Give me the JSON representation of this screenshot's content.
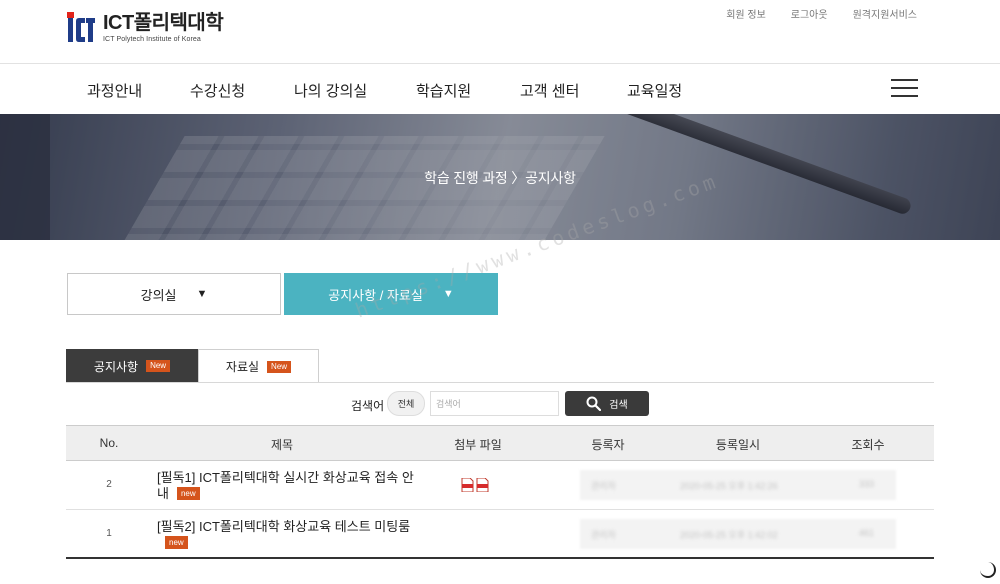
{
  "site": {
    "logo_title": "ICT폴리텍대학",
    "logo_subtitle": "ICT Polytech Institute of Korea"
  },
  "utility_links": [
    "회원 정보",
    "로그아웃",
    "원격지원서비스"
  ],
  "gnb": [
    "과정안내",
    "수강신청",
    "나의 강의실",
    "학습지원",
    "고객 센터",
    "교육일정"
  ],
  "banner": {
    "breadcrumb": "학습 진행 과정 〉공지사항"
  },
  "selectors": {
    "lecture_room": "강의실",
    "notice_data": "공지사항 / 자료실",
    "arrow": "▼"
  },
  "content_tabs": {
    "notice": "공지사항",
    "library": "자료실",
    "badge": "New"
  },
  "search": {
    "label": "검색어",
    "scope": "전체",
    "placeholder": "검색어",
    "button": "검색"
  },
  "table": {
    "headers": [
      "No.",
      "제목",
      "첨부 파일",
      "등록자",
      "등록일시",
      "조회수"
    ],
    "rows": [
      {
        "no": "2",
        "title": "[필독1] ICT폴리텍대학 실시간 화상교육 접속 안내",
        "badge": "new",
        "attachments": 2,
        "author": "관리자",
        "date": "2020-05-25 오후 1:42:26",
        "views": "333"
      },
      {
        "no": "1",
        "title": "[필독2] ICT폴리텍대학 화상교육 테스트 미팅룸",
        "badge": "new",
        "attachments": 0,
        "author": "관리자",
        "date": "2020-05-25 오후 1:42:02",
        "views": "461"
      }
    ]
  },
  "watermark": "https://www.codeslog.com",
  "colors": {
    "accent_teal": "#4bb3c1",
    "badge_orange": "#d5541c",
    "dark_tab": "#3c3c3c"
  }
}
